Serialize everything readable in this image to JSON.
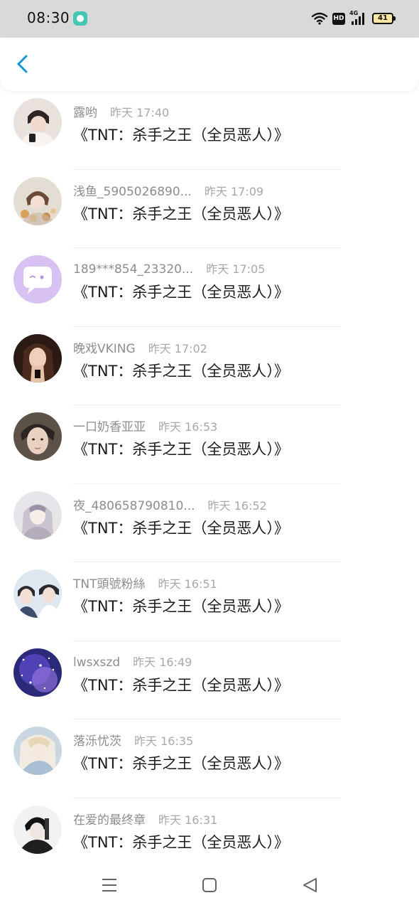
{
  "status_bar": {
    "time": "08:30",
    "hd": "HD",
    "network": "4G",
    "battery": "41"
  },
  "header": {
    "back_icon": "chevron-left-icon",
    "accent_color": "#1296db"
  },
  "items": [
    {
      "name": "露哟",
      "time": "昨天 17:40",
      "message": "《TNT：杀手之王（全员恶人）》"
    },
    {
      "name": "浅鱼_5905026890...",
      "time": "昨天 17:09",
      "message": "《TNT：杀手之王（全员恶人）》"
    },
    {
      "name": "189***854_23320...",
      "time": "昨天 17:05",
      "message": "《TNT：杀手之王（全员恶人）》"
    },
    {
      "name": "晚戏VKING",
      "time": "昨天 17:02",
      "message": "《TNT：杀手之王（全员恶人）》"
    },
    {
      "name": "一口奶香亚亚",
      "time": "昨天 16:53",
      "message": "《TNT：杀手之王（全员恶人）》"
    },
    {
      "name": "夜_480658790810...",
      "time": "昨天 16:52",
      "message": "《TNT：杀手之王（全员恶人）》"
    },
    {
      "name": "TNT頭號粉絲",
      "time": "昨天 16:51",
      "message": "《TNT：杀手之王（全员恶人）》"
    },
    {
      "name": "lwsxszd",
      "time": "昨天 16:49",
      "message": "《TNT：杀手之王（全员恶人）》"
    },
    {
      "name": "落泺忧茨",
      "time": "昨天 16:35",
      "message": "《TNT：杀手之王（全员恶人）》"
    },
    {
      "name": "在爱的最终章",
      "time": "昨天 16:31",
      "message": "《TNT：杀手之王（全员恶人）》"
    }
  ],
  "nav_bar": {
    "menu_icon": "menu-icon",
    "home_icon": "home-square-icon",
    "back_icon": "back-triangle-icon"
  }
}
